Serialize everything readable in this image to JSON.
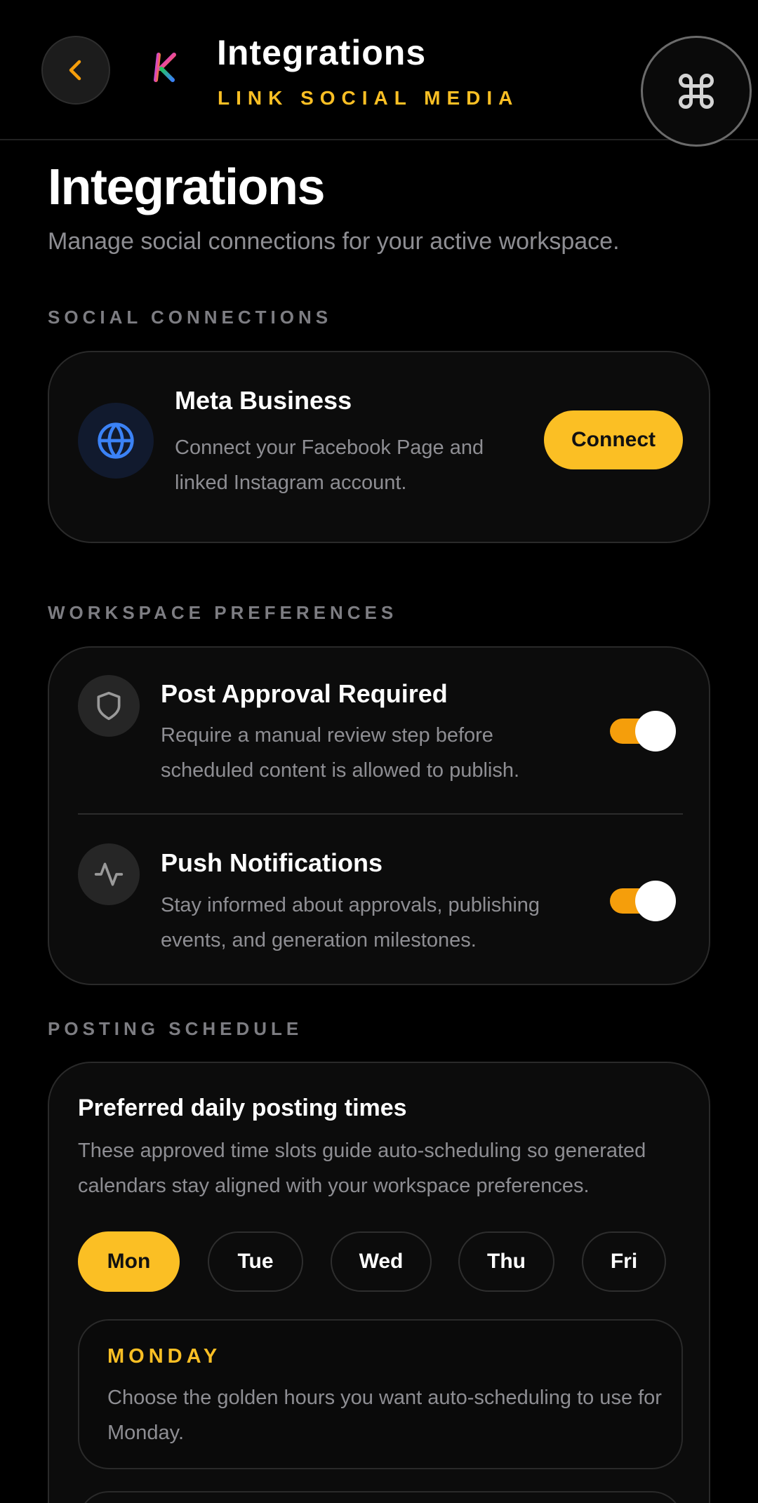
{
  "header": {
    "title": "Integrations",
    "subtitle": "LINK SOCIAL MEDIA",
    "back_icon": "chevron-left-icon",
    "logo": "k-logo",
    "command_icon": "command-icon"
  },
  "page": {
    "title": "Integrations",
    "description": "Manage social connections for your active workspace."
  },
  "sections": {
    "social": "SOCIAL CONNECTIONS",
    "preferences": "WORKSPACE PREFERENCES",
    "schedule": "POSTING SCHEDULE"
  },
  "meta": {
    "icon": "globe-icon",
    "title": "Meta Business",
    "description_line1": "Connect your Facebook Page and",
    "description_line2": "linked Instagram account.",
    "button": "Connect"
  },
  "preferences": [
    {
      "icon": "shield-icon",
      "title": "Post Approval Required",
      "description_line1": "Require a manual review step before",
      "description_line2": "scheduled content is allowed to publish.",
      "enabled": true
    },
    {
      "icon": "activity-icon",
      "title": "Push Notifications",
      "description_line1": "Stay informed about approvals, publishing",
      "description_line2": "events, and generation milestones.",
      "enabled": true
    }
  ],
  "schedule": {
    "title": "Preferred daily posting times",
    "description_line1": "These approved time slots guide auto-scheduling so generated",
    "description_line2": "calendars stay aligned with your workspace preferences.",
    "days": [
      "Mon",
      "Tue",
      "Wed",
      "Thu",
      "Fri"
    ],
    "selected_day": "Mon",
    "day_card": {
      "title": "MONDAY",
      "description": "Choose the golden hours you want auto-scheduling to use for Monday."
    }
  },
  "colors": {
    "accent": "#fbbf24",
    "toggle_on": "#f59e0b",
    "muted_text": "#8e8e93",
    "meta_icon": "#3b82f6"
  }
}
